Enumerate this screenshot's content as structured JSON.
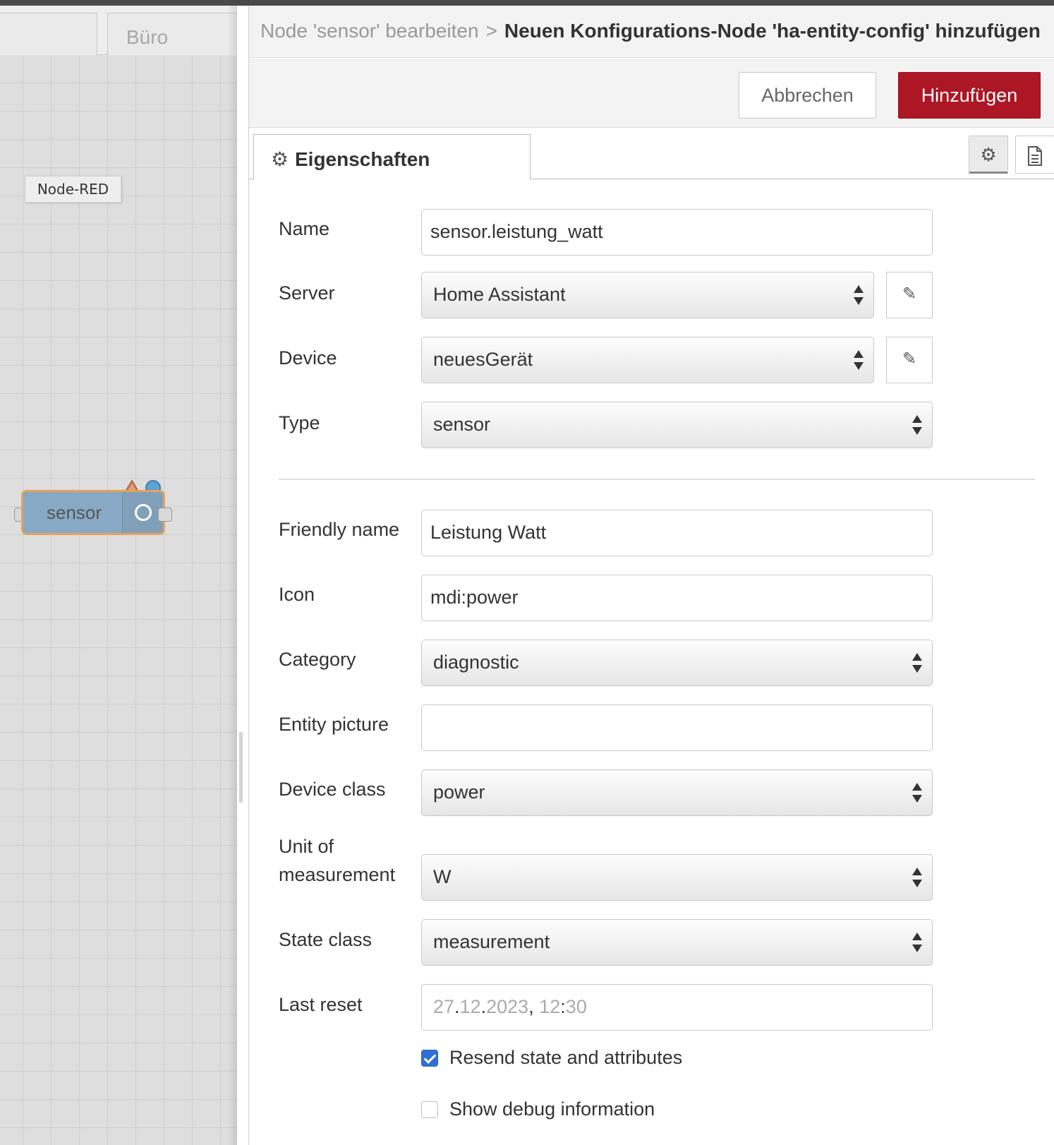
{
  "workspace": {
    "tabs": [
      "",
      "Büro"
    ],
    "tooltip": "Node-RED",
    "node": {
      "label": "sensor",
      "node_color": "#87a9c5",
      "border_color": "#e7a15c"
    }
  },
  "editor": {
    "breadcrumb": {
      "crumb": "Node 'sensor' bearbeiten",
      "separator": ">",
      "title": "Neuen Konfigurations-Node 'ha-entity-config' hinzufügen"
    },
    "buttons": {
      "cancel": "Abbrechen",
      "add": "Hinzufügen",
      "add_color": "#ad1625"
    },
    "tabs": {
      "properties": "Eigenschaften",
      "properties_icon": "gear-icon",
      "settings_icon": "gear-icon",
      "description_icon": "file-text-icon"
    },
    "form": {
      "name": {
        "label": "Name",
        "value": "sensor.leistung_watt"
      },
      "server": {
        "label": "Server",
        "value": "Home Assistant"
      },
      "device": {
        "label": "Device",
        "value": "neuesGerät"
      },
      "type": {
        "label": "Type",
        "value": "sensor"
      },
      "friendly_name": {
        "label": "Friendly name",
        "value": "Leistung Watt"
      },
      "icon": {
        "label": "Icon",
        "value": "mdi:power"
      },
      "category": {
        "label": "Category",
        "value": "diagnostic"
      },
      "entity_picture": {
        "label": "Entity picture",
        "value": ""
      },
      "device_class": {
        "label": "Device class",
        "value": "power"
      },
      "unit_of_measurement": {
        "label_line1": "Unit of",
        "label_line2": "measurement",
        "value": "W"
      },
      "state_class": {
        "label": "State class",
        "value": "measurement"
      },
      "last_reset": {
        "label": "Last reset",
        "day": "27",
        "month": "12",
        "year": "2023",
        "hour": "12",
        "minute": "30",
        "dot": ".",
        "comma": ",",
        "colon": ":"
      },
      "resend": {
        "label": "Resend state and attributes",
        "checked": true
      },
      "debug": {
        "label": "Show debug information",
        "checked": false
      }
    }
  }
}
